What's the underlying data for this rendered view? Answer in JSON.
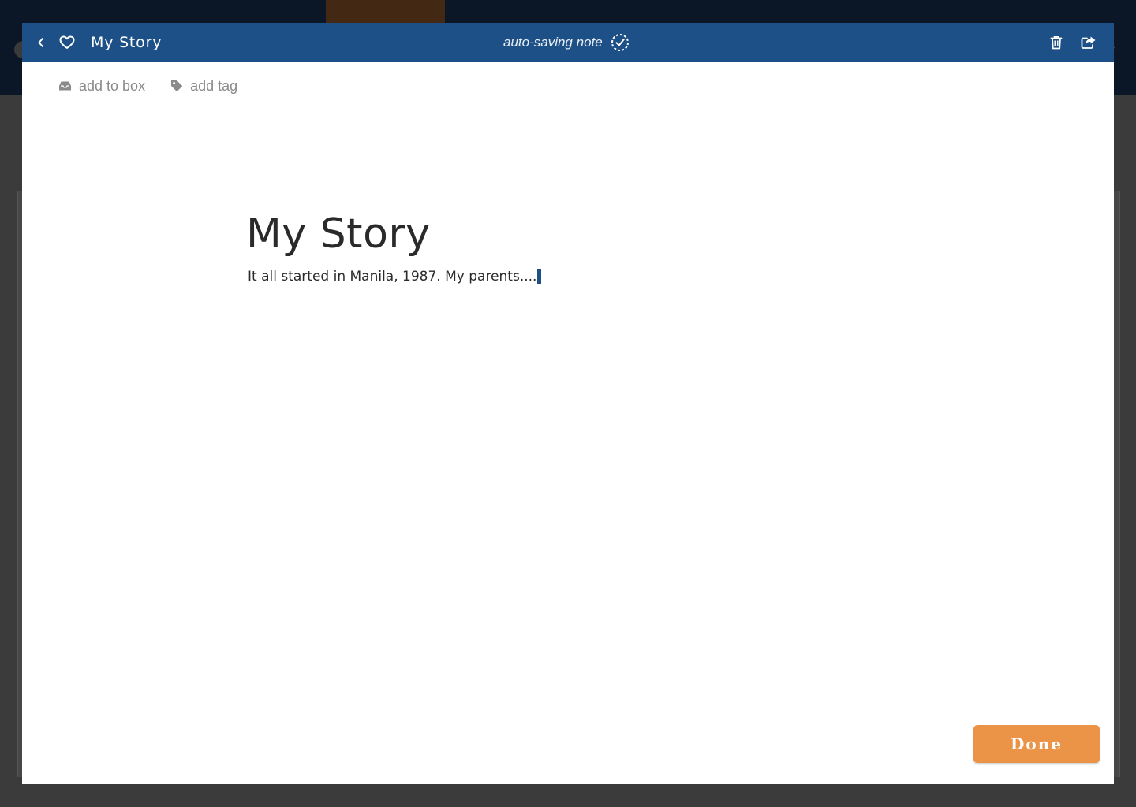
{
  "header": {
    "title": "My Story",
    "status": "auto-saving note",
    "icons": [
      "chevron-left-icon",
      "heart-icon",
      "save-check-icon",
      "trash-icon",
      "share-icon"
    ]
  },
  "meta": {
    "add_to_box": "add to box",
    "add_tag": "add tag"
  },
  "document": {
    "title": "My Story",
    "body": "It all started in Manila, 1987. My parents...."
  },
  "actions": {
    "done_label": "Done"
  },
  "colors": {
    "header": "#1d5086",
    "done_button": "#eb9447",
    "muted_text": "#8a8a8a",
    "caret": "#1d5086"
  }
}
